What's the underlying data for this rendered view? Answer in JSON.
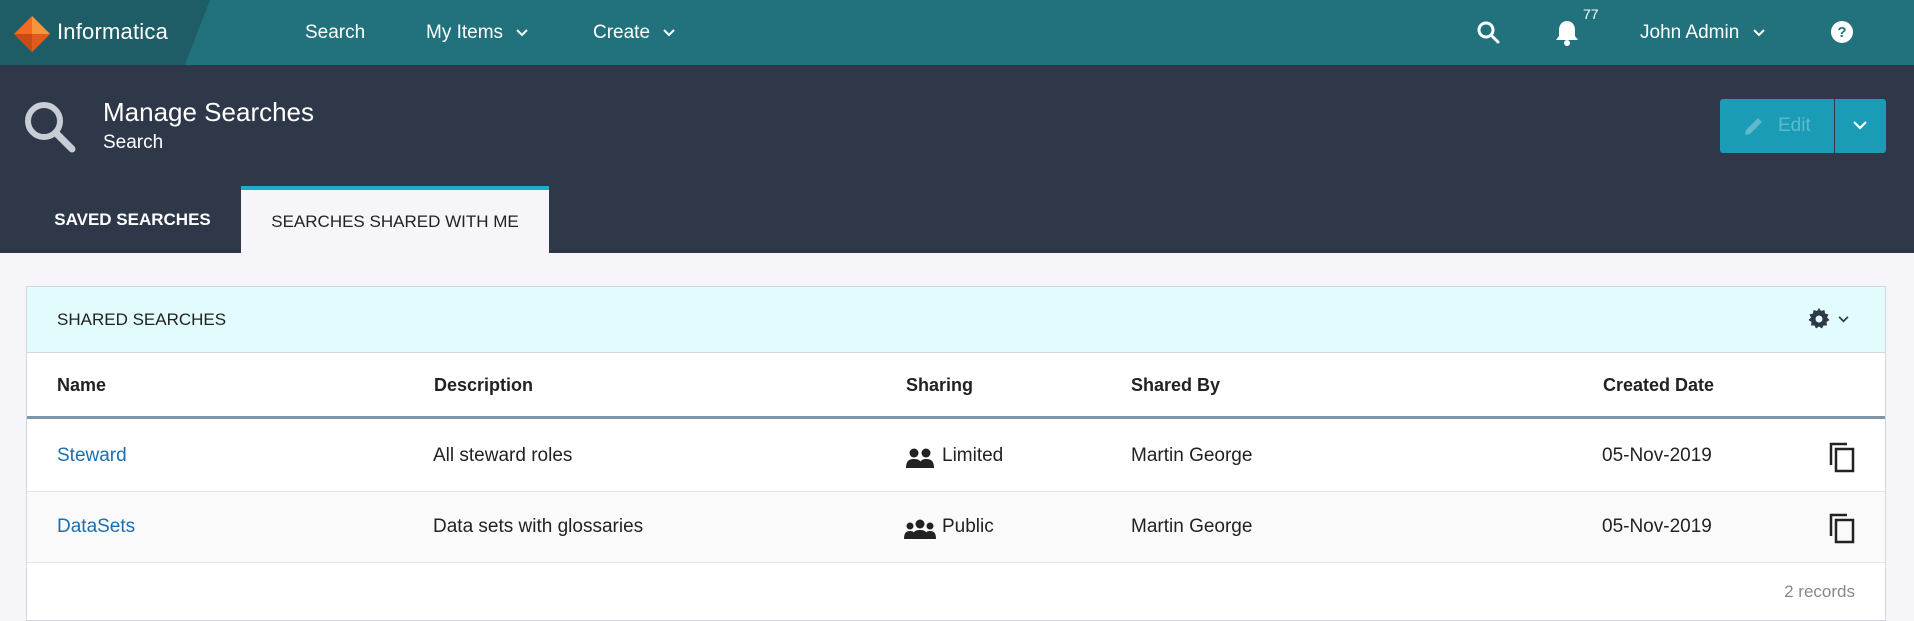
{
  "app": {
    "logo_text": "Informatica",
    "brand_color": "#f26b21"
  },
  "nav": {
    "items": [
      {
        "label": "Search"
      },
      {
        "label": "My Items"
      },
      {
        "label": "Create"
      }
    ],
    "notification_count": "77",
    "user_name": "John Admin",
    "icons": [
      "search-icon",
      "bell-icon",
      "help-icon"
    ]
  },
  "header": {
    "title": "Manage Searches",
    "subtitle": "Search",
    "edit_label": "Edit"
  },
  "tabs": [
    {
      "label": "SAVED SEARCHES",
      "active": false
    },
    {
      "label": "SEARCHES SHARED WITH ME",
      "active": true
    }
  ],
  "panel": {
    "title": "SHARED SEARCHES",
    "columns": [
      "Name",
      "Description",
      "Sharing",
      "Shared By",
      "Created Date"
    ],
    "rows": [
      {
        "name": "Steward",
        "description": "All steward roles",
        "sharing": "Limited",
        "sharing_icon": "group-icon",
        "shared_by": "Martin George",
        "created": "05-Nov-2019"
      },
      {
        "name": "DataSets",
        "description": "Data sets with glossaries",
        "sharing": "Public",
        "sharing_icon": "public-group-icon",
        "shared_by": "Martin George",
        "created": "05-Nov-2019"
      }
    ],
    "record_count": "2 records"
  },
  "colors": {
    "topnav": "#21727d",
    "header": "#2e3849",
    "accent": "#1ab0c8",
    "button": "#1a9cb6",
    "link": "#1a6fb0"
  }
}
